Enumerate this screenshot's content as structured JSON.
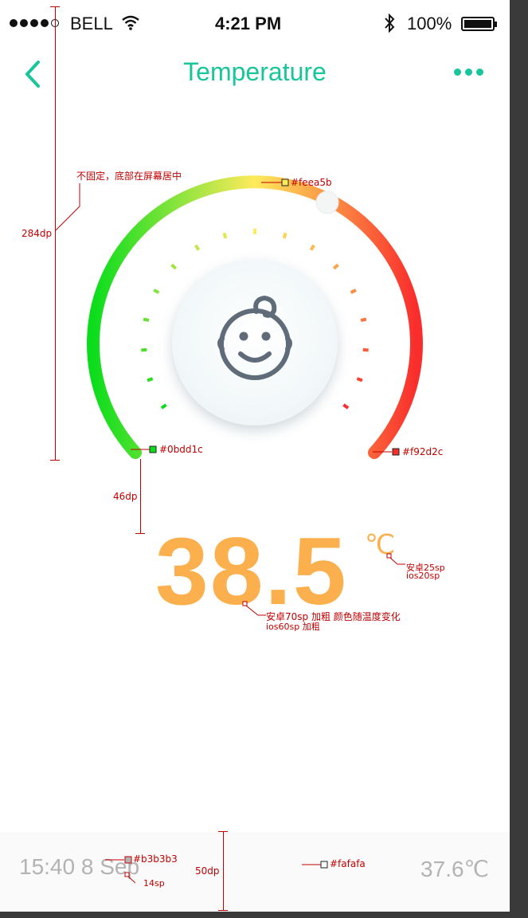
{
  "status_bar": {
    "carrier": "BELL",
    "time": "4:21 PM",
    "battery": "100%",
    "signal_icon": "signal-dots-icon",
    "wifi_icon": "wifi-icon",
    "bluetooth_icon": "bluetooth-icon",
    "battery_icon": "battery-icon"
  },
  "nav": {
    "title": "Temperature",
    "back_icon": "chevron-left-icon",
    "more_icon": "more-dots-icon"
  },
  "gauge": {
    "icon": "baby-face-icon",
    "colors": {
      "start": "#0bdd1c",
      "middle": "#feea5b",
      "end": "#f92d2c"
    },
    "accent": "#19c59a"
  },
  "reading": {
    "value": "38.5",
    "unit": "℃",
    "color": "#fcb04d"
  },
  "bottom_bar": {
    "time": "15:40 8 Sep",
    "last_temp": "37.6℃",
    "background": "#fafafa",
    "text_color": "#b3b3b3"
  },
  "annotations": {
    "note_center": "不固定，底部在屏幕居中",
    "height_284": "284dp",
    "color_top": "#feea5b",
    "color_left": "#0bdd1c",
    "color_right": "#f92d2c",
    "gap_46": "46dp",
    "value_font_1": "安卓70sp 加粗 颜色随温度变化",
    "value_font_2": "ios60sp 加粗",
    "unit_font_1": "安卓25sp",
    "unit_font_2": "ios20sp",
    "bar_text_color": "#b3b3b3",
    "bar_font": "14sp",
    "bar_height": "50dp",
    "bar_bg": "#fafafa"
  }
}
